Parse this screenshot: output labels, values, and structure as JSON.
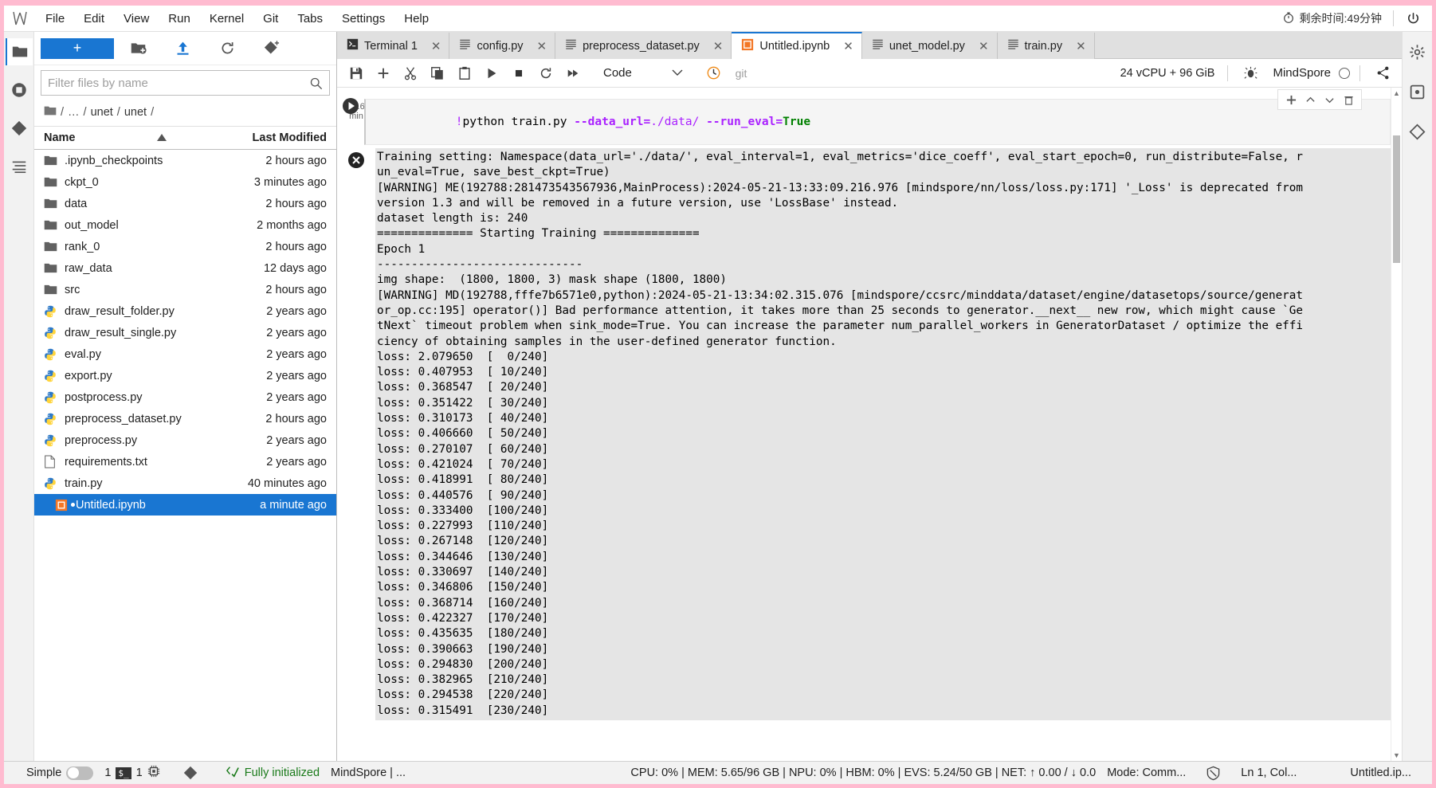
{
  "window": {
    "accent": "#1976d2",
    "frame_color": "#ffbbd0"
  },
  "menubar": {
    "logo": "jupyter-logo-icon",
    "items": [
      "File",
      "Edit",
      "View",
      "Run",
      "Kernel",
      "Git",
      "Tabs",
      "Settings",
      "Help"
    ],
    "timer_icon": "stopwatch-icon",
    "timer_text": "剩余时间:49分钟",
    "power_icon": "power-icon"
  },
  "left_rail": {
    "items": [
      {
        "name": "file-browser-icon",
        "glyph": "folder"
      },
      {
        "name": "running-terminals-icon",
        "glyph": "stop"
      },
      {
        "name": "git-icon",
        "glyph": "git"
      },
      {
        "name": "table-of-contents-icon",
        "glyph": "toc"
      }
    ]
  },
  "right_rail": {
    "items": [
      {
        "name": "settings-gear-icon",
        "glyph": "gear"
      },
      {
        "name": "extension-manager-icon",
        "glyph": "ext"
      },
      {
        "name": "property-inspector-icon",
        "glyph": "inspector"
      }
    ]
  },
  "filebrowser": {
    "new_button_label": "+",
    "toolbar_icons": [
      "new-folder-icon",
      "upload-icon",
      "refresh-icon",
      "new-git-icon"
    ],
    "filter_placeholder": "Filter files by name",
    "filter_value": "",
    "search_icon": "search-icon",
    "breadcrumb": [
      "/",
      "…",
      "/",
      "unet",
      "/",
      "unet",
      "/"
    ],
    "columns": [
      "Name",
      "Last Modified"
    ],
    "sort_icon": "sort-ascending-icon",
    "files": [
      {
        "name": ".ipynb_checkpoints",
        "modified": "2 hours ago",
        "type": "folder",
        "selected": false
      },
      {
        "name": "ckpt_0",
        "modified": "3 minutes ago",
        "type": "folder",
        "selected": false
      },
      {
        "name": "data",
        "modified": "2 hours ago",
        "type": "folder",
        "selected": false
      },
      {
        "name": "out_model",
        "modified": "2 months ago",
        "type": "folder",
        "selected": false
      },
      {
        "name": "rank_0",
        "modified": "2 hours ago",
        "type": "folder",
        "selected": false
      },
      {
        "name": "raw_data",
        "modified": "12 days ago",
        "type": "folder",
        "selected": false
      },
      {
        "name": "src",
        "modified": "2 hours ago",
        "type": "folder",
        "selected": false
      },
      {
        "name": "draw_result_folder.py",
        "modified": "2 years ago",
        "type": "python",
        "selected": false
      },
      {
        "name": "draw_result_single.py",
        "modified": "2 years ago",
        "type": "python",
        "selected": false
      },
      {
        "name": "eval.py",
        "modified": "2 years ago",
        "type": "python",
        "selected": false
      },
      {
        "name": "export.py",
        "modified": "2 years ago",
        "type": "python",
        "selected": false
      },
      {
        "name": "postprocess.py",
        "modified": "2 years ago",
        "type": "python",
        "selected": false
      },
      {
        "name": "preprocess_dataset.py",
        "modified": "2 hours ago",
        "type": "python",
        "selected": false
      },
      {
        "name": "preprocess.py",
        "modified": "2 years ago",
        "type": "python",
        "selected": false
      },
      {
        "name": "requirements.txt",
        "modified": "2 years ago",
        "type": "text",
        "selected": false
      },
      {
        "name": "train.py",
        "modified": "40 minutes ago",
        "type": "python",
        "selected": false
      },
      {
        "name": "Untitled.ipynb",
        "modified": "a minute ago",
        "type": "notebook",
        "selected": true
      }
    ]
  },
  "tabs": [
    {
      "label": "Terminal 1",
      "icon": "terminal-icon",
      "active": false
    },
    {
      "label": "config.py",
      "icon": "text-file-icon",
      "active": false
    },
    {
      "label": "preprocess_dataset.py",
      "icon": "text-file-icon",
      "active": false
    },
    {
      "label": "Untitled.ipynb",
      "icon": "notebook-icon",
      "active": true
    },
    {
      "label": "unet_model.py",
      "icon": "text-file-icon",
      "active": false
    },
    {
      "label": "train.py",
      "icon": "text-file-icon",
      "active": false
    }
  ],
  "notebook_toolbar": {
    "buttons": [
      {
        "name": "save-button",
        "glyph": "save-icon"
      },
      {
        "name": "insert-cell-button",
        "glyph": "plus-icon"
      },
      {
        "name": "cut-cell-button",
        "glyph": "scissors-icon"
      },
      {
        "name": "copy-cell-button",
        "glyph": "copy-icon"
      },
      {
        "name": "paste-cell-button",
        "glyph": "clipboard-icon"
      },
      {
        "name": "run-cell-button",
        "glyph": "play-icon"
      },
      {
        "name": "stop-kernel-button",
        "glyph": "stop-icon"
      },
      {
        "name": "restart-kernel-button",
        "glyph": "restart-icon"
      },
      {
        "name": "restart-run-all-button",
        "glyph": "fast-forward-icon"
      }
    ],
    "celltype_value": "Code",
    "chevron": "chevron-down-icon",
    "clock_icon": "clock-icon",
    "git_label": "git",
    "resource_label": "24 vCPU + 96 GiB",
    "debug_icon": "bug-icon",
    "kernel_name": "MindSpore",
    "kernel_status": "idle-circle-icon",
    "share_icon": "share-icon"
  },
  "cell_tools": {
    "add_icon": "plus-icon",
    "up_icon": "chevron-up-icon",
    "down_icon": "chevron-down-icon",
    "delete_icon": "trash-icon"
  },
  "notebook": {
    "cell": {
      "exec_time": "36.6",
      "exec_unit": "min",
      "run_icon": "play-circle-icon",
      "source_prefix": "!",
      "source_cmd": "python train.py ",
      "source_flag1": "--data_url",
      "source_eq1": "=",
      "source_val1": "./data/ ",
      "source_flag2": "--run_eval",
      "source_eq2": "=",
      "source_val2": "True",
      "output_status_icon": "error-x-icon"
    },
    "output_lines": [
      "Training setting: Namespace(data_url='./data/', eval_interval=1, eval_metrics='dice_coeff', eval_start_epoch=0, run_distribute=False, r",
      "un_eval=True, save_best_ckpt=True)",
      "[WARNING] ME(192788:281473543567936,MainProcess):2024-05-21-13:33:09.216.976 [mindspore/nn/loss/loss.py:171] '_Loss' is deprecated from",
      "version 1.3 and will be removed in a future version, use 'LossBase' instead.",
      "dataset length is: 240",
      "============== Starting Training ==============",
      "Epoch 1",
      "------------------------------",
      "img shape:  (1800, 1800, 3) mask shape (1800, 1800)",
      "[WARNING] MD(192788,fffe7b6571e0,python):2024-05-21-13:34:02.315.076 [mindspore/ccsrc/minddata/dataset/engine/datasetops/source/generat",
      "or_op.cc:195] operator()] Bad performance attention, it takes more than 25 seconds to generator.__next__ new row, which might cause `Ge",
      "tNext` timeout problem when sink_mode=True. You can increase the parameter num_parallel_workers in GeneratorDataset / optimize the effi",
      "ciency of obtaining samples in the user-defined generator function.",
      "loss: 2.079650  [  0/240]",
      "loss: 0.407953  [ 10/240]",
      "loss: 0.368547  [ 20/240]",
      "loss: 0.351422  [ 30/240]",
      "loss: 0.310173  [ 40/240]",
      "loss: 0.406660  [ 50/240]",
      "loss: 0.270107  [ 60/240]",
      "loss: 0.421024  [ 70/240]",
      "loss: 0.418991  [ 80/240]",
      "loss: 0.440576  [ 90/240]",
      "loss: 0.333400  [100/240]",
      "loss: 0.227993  [110/240]",
      "loss: 0.267148  [120/240]",
      "loss: 0.344646  [130/240]",
      "loss: 0.330697  [140/240]",
      "loss: 0.346806  [150/240]",
      "loss: 0.368714  [160/240]",
      "loss: 0.422327  [170/240]",
      "loss: 0.435635  [180/240]",
      "loss: 0.390663  [190/240]",
      "loss: 0.294830  [200/240]",
      "loss: 0.382965  [210/240]",
      "loss: 0.294538  [220/240]",
      "loss: 0.315491  [230/240]"
    ]
  },
  "statusbar": {
    "simple_label": "Simple",
    "simple_on": false,
    "kernel_count": "1",
    "terminal_badge": "$_",
    "terminal_count": "1",
    "cpu_icon": "chip-icon",
    "git_icon": "git-icon",
    "init_icon": "code-check-icon",
    "init_text": "Fully initialized",
    "kernel_text": "MindSpore | ...",
    "metrics": "CPU: 0%  |  MEM: 5.65/96 GB  |  NPU: 0%  |  HBM: 0%  |  EVS: 5.24/50 GB  |  NET: ↑ 0.00 / ↓ 0.0",
    "mode": "Mode: Comm...",
    "shield_icon": "shield-off-icon",
    "position": "Ln 1, Col...",
    "filename": "Untitled.ip..."
  }
}
